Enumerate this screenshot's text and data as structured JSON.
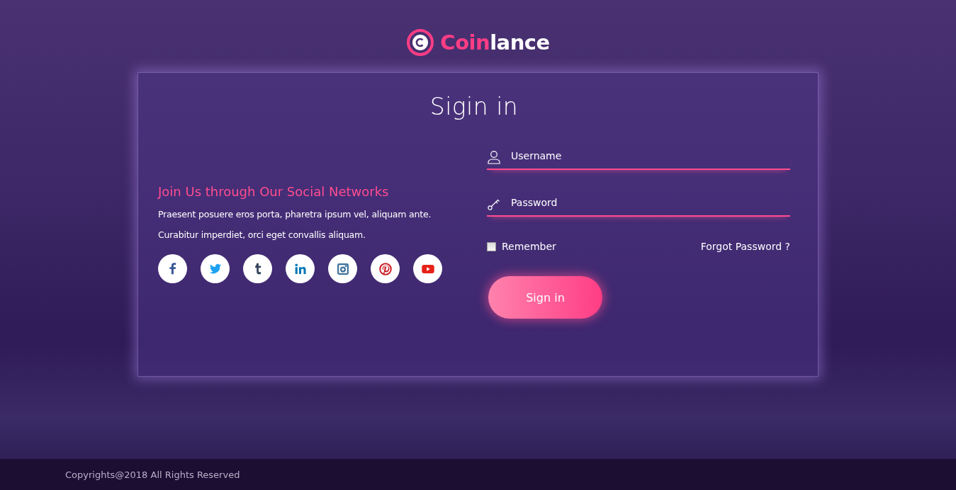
{
  "brand": {
    "accent": "Coin",
    "rest": "lance"
  },
  "card": {
    "title": "Sigin in",
    "social": {
      "heading": "Join Us through Our Social Networks",
      "lines": [
        "Praesent posuere eros porta, pharetra ipsum vel, aliquam ante.",
        "Curabitur imperdiet, orci eget convallis aliquam."
      ],
      "networks": [
        {
          "kind": "facebook",
          "color": "#3b5998"
        },
        {
          "kind": "twitter",
          "color": "#1da1f2"
        },
        {
          "kind": "tumblr",
          "color": "#35465c"
        },
        {
          "kind": "linkedin",
          "color": "#0077b5"
        },
        {
          "kind": "instagram",
          "color": "#3f729b"
        },
        {
          "kind": "pinterest",
          "color": "#cb2027"
        },
        {
          "kind": "youtube",
          "color": "#e62117"
        }
      ]
    },
    "form": {
      "fields": [
        {
          "kind": "user",
          "placeholder": "Username"
        },
        {
          "kind": "key",
          "placeholder": "Password"
        }
      ],
      "remember": {
        "label": "Remember",
        "checked": false
      },
      "forgot": "Forgot Password ?",
      "submit": "Sign in"
    }
  },
  "footer": "Copyrights@2018 All Rights Reserved"
}
